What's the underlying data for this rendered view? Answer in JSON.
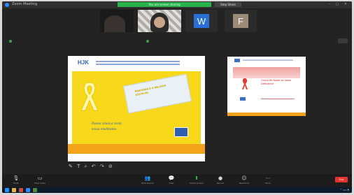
{
  "window": {
    "title": "Zoom Meeting"
  },
  "share_banner": {
    "text": "You are screen sharing",
    "stop_label": "Stop Share"
  },
  "participants": [
    {
      "name": "",
      "type": "video"
    },
    {
      "name": "",
      "type": "video"
    },
    {
      "name": "",
      "type": "initial",
      "initial": "W",
      "color": "#2a6fd6"
    },
    {
      "name": "",
      "type": "initial",
      "initial": "F",
      "color": "#9b8a76"
    }
  ],
  "slides": {
    "main": {
      "logo": "HJK",
      "message_line1": "Passar sinais a visita",
      "message_line2": "nossa rendimento",
      "card_text": "PREVENIR É A MELHOR ESCOLHA"
    },
    "side": {
      "text": "Grupo de Apoio ao Idoso Deficiente"
    }
  },
  "annotation_tools": [
    "✎",
    "T",
    "⌕",
    "↶",
    "↷",
    "⊘"
  ],
  "toolbar": {
    "items": [
      {
        "icon": "🎙",
        "label": "Mute"
      },
      {
        "icon": "▭",
        "label": "Stop Video"
      },
      {
        "icon": "👥",
        "label": "Participants"
      },
      {
        "icon": "💬",
        "label": "Chat"
      },
      {
        "icon": "⬆",
        "label": "Share Screen"
      },
      {
        "icon": "●",
        "label": "Record"
      },
      {
        "icon": "☺",
        "label": "Reactions"
      },
      {
        "icon": "⋯",
        "label": "More"
      }
    ],
    "end_label": "End"
  },
  "colors": {
    "slide_yellow": "#f7d81a",
    "slide_orange": "#f3a21a",
    "share_green": "#27b34a",
    "end_red": "#e5322e"
  }
}
